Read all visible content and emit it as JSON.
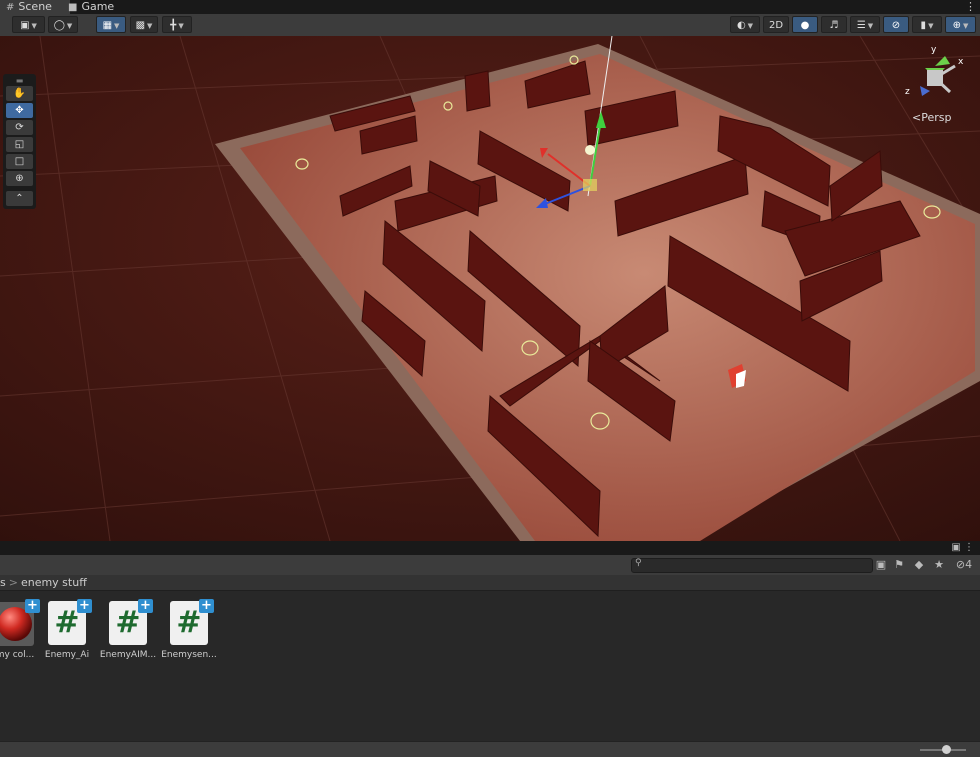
{
  "tabs": {
    "scene": "Scene",
    "game": "Game"
  },
  "toolbar": {
    "btn_2d": "2D"
  },
  "scene_view": {
    "projection": "Persp",
    "gizmo_labels": {
      "y": "y",
      "z": "z",
      "x": "x"
    }
  },
  "tools": [
    "view-tool",
    "move-tool",
    "rotate-tool",
    "scale-tool",
    "rect-tool",
    "transform-tool",
    "custom-tool"
  ],
  "project": {
    "hidden_count": "4",
    "breadcrumb": {
      "prev": "s",
      "current": "enemy stuff"
    },
    "assets": [
      {
        "label": "my col...",
        "type": "material"
      },
      {
        "label": "Enemy_Ai",
        "type": "script"
      },
      {
        "label": "EnemyAIM...",
        "type": "script"
      },
      {
        "label": "Enemysen...",
        "type": "script"
      }
    ],
    "script_glyph": "#",
    "add_glyph": "+"
  },
  "colors": {
    "accent": "#3a5b80",
    "plus_badge": "#2f8fd0",
    "script_hash": "#1e6a2f",
    "maze_floor": "#b86a55",
    "maze_wall": "#5a1410",
    "ground": "#3e1612"
  }
}
